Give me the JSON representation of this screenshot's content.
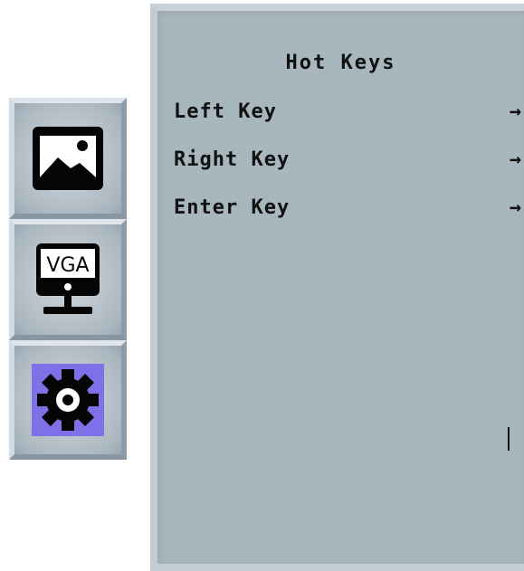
{
  "sidebar": {
    "items": [
      {
        "icon": "picture-icon",
        "label": ""
      },
      {
        "icon": "vga-monitor-icon",
        "label": "VGA"
      },
      {
        "icon": "gear-icon",
        "label": "",
        "selected": true
      }
    ]
  },
  "menu": {
    "title": "Hot Keys",
    "items": [
      {
        "label": "Left Key",
        "arrow": "→"
      },
      {
        "label": "Right Key",
        "arrow": "→"
      },
      {
        "label": "Enter Key",
        "arrow": "→"
      }
    ]
  },
  "colors": {
    "panel_bg": "#a8b6bd",
    "selected_icon_bg": "#7f70e8",
    "text": "#111111"
  }
}
